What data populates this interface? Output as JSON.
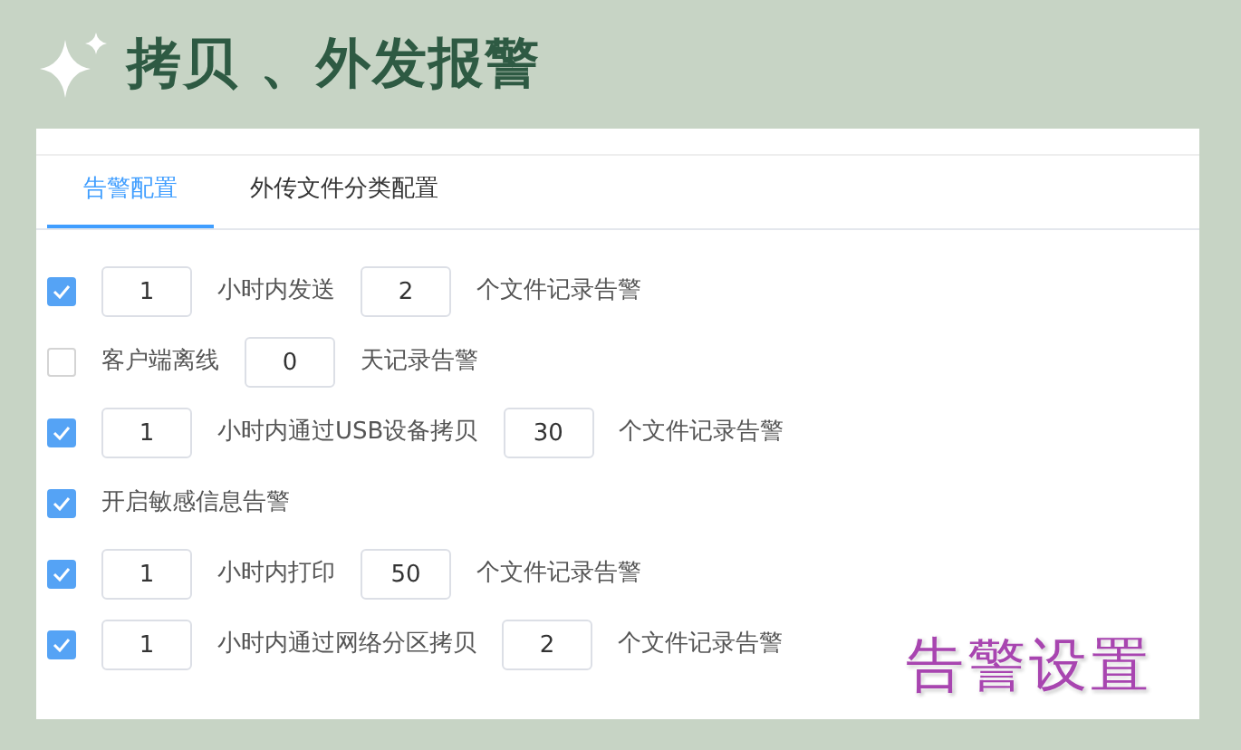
{
  "header": {
    "title": "拷贝 、外发报警"
  },
  "tabs": [
    {
      "label": "告警配置",
      "selected": true
    },
    {
      "label": "外传文件分类配置",
      "selected": false
    }
  ],
  "rows": [
    {
      "checked": true,
      "parts": [
        {
          "kind": "number",
          "value": "1"
        },
        {
          "kind": "text",
          "text": "小时内发送"
        },
        {
          "kind": "number",
          "value": "2"
        },
        {
          "kind": "text",
          "text": "个文件记录告警"
        }
      ]
    },
    {
      "checked": false,
      "parts": [
        {
          "kind": "text",
          "text": "客户端离线"
        },
        {
          "kind": "number",
          "value": "0"
        },
        {
          "kind": "text",
          "text": "天记录告警"
        }
      ]
    },
    {
      "checked": true,
      "parts": [
        {
          "kind": "number",
          "value": "1"
        },
        {
          "kind": "text",
          "text": "小时内通过USB设备拷贝"
        },
        {
          "kind": "number",
          "value": "30"
        },
        {
          "kind": "text",
          "text": "个文件记录告警"
        }
      ]
    },
    {
      "checked": true,
      "parts": [
        {
          "kind": "text",
          "text": "开启敏感信息告警"
        }
      ]
    },
    {
      "checked": true,
      "parts": [
        {
          "kind": "number",
          "value": "1"
        },
        {
          "kind": "text",
          "text": "小时内打印"
        },
        {
          "kind": "number",
          "value": "50"
        },
        {
          "kind": "text",
          "text": "个文件记录告警"
        }
      ]
    },
    {
      "checked": true,
      "parts": [
        {
          "kind": "number",
          "value": "1"
        },
        {
          "kind": "text",
          "text": "小时内通过网络分区拷贝"
        },
        {
          "kind": "number",
          "value": "2"
        },
        {
          "kind": "text",
          "text": "个文件记录告警"
        }
      ]
    }
  ],
  "caption": {
    "text": "告警设置"
  }
}
